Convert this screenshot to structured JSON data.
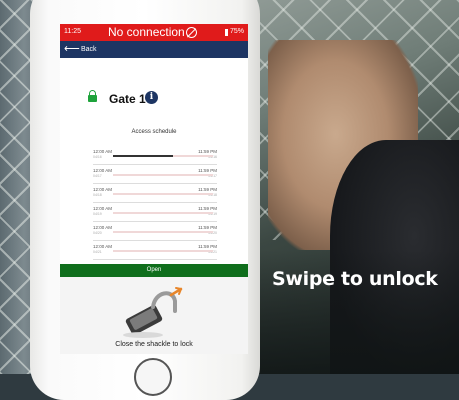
{
  "status_bar": {
    "time": "11:25",
    "connection": "No connection",
    "battery": "75%",
    "color": "#e01b1b"
  },
  "nav": {
    "back_label": "Back",
    "color": "#1d3563"
  },
  "gate": {
    "name": "Gate 1",
    "info_glyph": "i",
    "lock_icon": "unlocked-padlock-icon",
    "lock_color": "#1ea33b"
  },
  "schedule": {
    "title": "Access schedule",
    "rows": [
      {
        "start": "12:00 AM",
        "end": "11:59 PM",
        "start_sub": "04/16",
        "end_sub": "04/16"
      },
      {
        "start": "12:00 AM",
        "end": "11:59 PM",
        "start_sub": "04/17",
        "end_sub": "04/17"
      },
      {
        "start": "12:00 AM",
        "end": "11:59 PM",
        "start_sub": "04/18",
        "end_sub": "04/18"
      },
      {
        "start": "12:00 AM",
        "end": "11:59 PM",
        "start_sub": "04/19",
        "end_sub": "04/19"
      },
      {
        "start": "12:00 AM",
        "end": "11:59 PM",
        "start_sub": "04/20",
        "end_sub": "04/20"
      },
      {
        "start": "12:00 AM",
        "end": "11:59 PM",
        "start_sub": "04/21",
        "end_sub": "04/21"
      },
      {
        "start": "12:00 AM",
        "end": "11:59 PM",
        "start_sub": "",
        "end_sub": ""
      }
    ],
    "first_row_progress": 0.6
  },
  "open_button": {
    "label": "Open",
    "color": "#0f6e1c"
  },
  "instruction": {
    "caption": "Close the shackle to lock"
  },
  "overlay": {
    "headline": "Swipe to unlock"
  }
}
